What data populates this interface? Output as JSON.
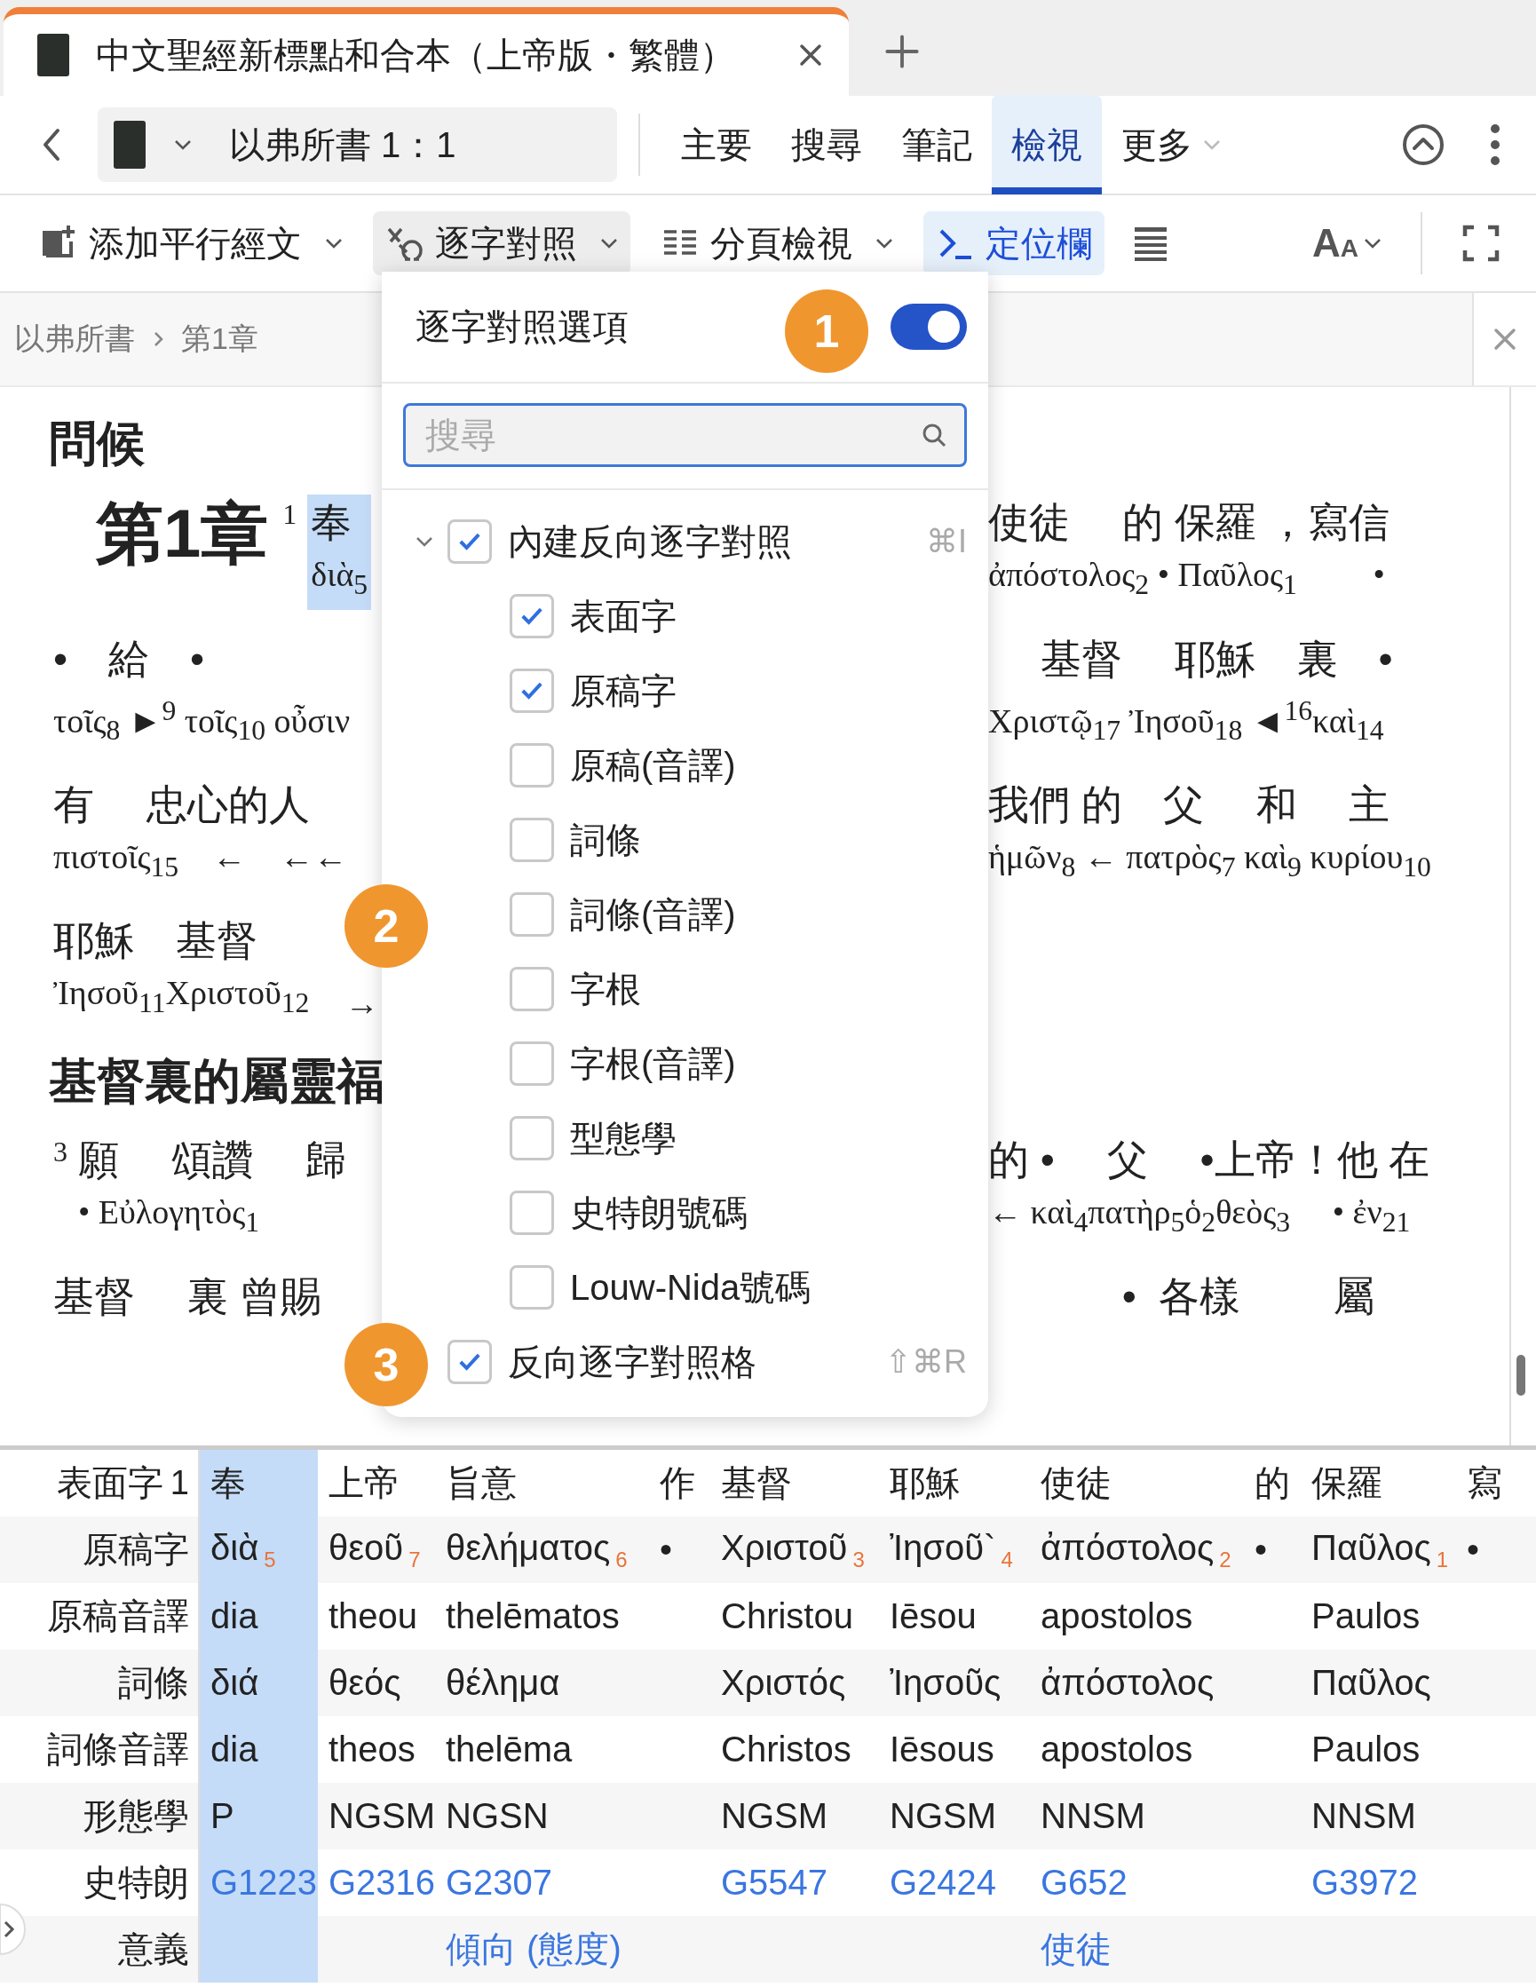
{
  "tab": {
    "title": "中文聖經新標點和合本（上帝版・繁體）"
  },
  "nav": {
    "location": "以弗所書 1：1",
    "tabs": [
      {
        "label": "主要",
        "selected": false,
        "has_menu": false
      },
      {
        "label": "搜尋",
        "selected": false,
        "has_menu": false
      },
      {
        "label": "筆記",
        "selected": false,
        "has_menu": false
      },
      {
        "label": "檢視",
        "selected": true,
        "has_menu": false
      },
      {
        "label": "更多",
        "selected": false,
        "has_menu": true
      }
    ]
  },
  "toolbar": {
    "items": [
      {
        "kind": "add-parallel",
        "label": "添加平行經文",
        "has_menu": true,
        "selected": false
      },
      {
        "kind": "interlinear",
        "label": "逐字對照",
        "has_menu": true,
        "selected": true
      },
      {
        "kind": "pages",
        "label": "分頁檢視",
        "has_menu": true,
        "selected": false
      },
      {
        "kind": "locator",
        "label": "定位欄",
        "has_menu": false,
        "selected": true
      }
    ],
    "font_button": {
      "large": "A",
      "small": "A"
    }
  },
  "breadcrumb": [
    "以弗所書",
    "第1章"
  ],
  "reader": {
    "blocks": [
      {
        "kind": "heading",
        "text": "問候"
      },
      {
        "kind": "line",
        "left": {
          "chapter": "第1章",
          "verse": "1",
          "units": [
            {
              "zh": "奉",
              "gk": "διὰ$_{5}$",
              "selected": true
            }
          ]
        },
        "right": {
          "units": [
            {
              "zh": "使徒　 的 保羅 ，寫信",
              "gk": "ἀπόστολος$_{2}$ • Παῦλος$_{1}$　　 •",
              "selected": false
            }
          ]
        }
      },
      {
        "kind": "line",
        "left": {
          "units": [
            {
              "zh": "•　給　•",
              "gk": "τοῖς$_{8}$ ►$^{9}$ τοῖς$_{10}$ οὖσιν",
              "selected": false
            }
          ]
        },
        "right": {
          "units": [
            {
              "zh": "　 基督　 耶穌　裏　•",
              "gk": "Χριστῷ$_{17}$ Ἰησοῦ$_{18}$ ◄$^{16}$καὶ$_{14}$",
              "selected": false
            }
          ]
        }
      },
      {
        "kind": "line",
        "left": {
          "units": [
            {
              "zh": "有　 忠心的人",
              "gk": "πιστοῖς$_{15}$　←　←←",
              "selected": false
            }
          ]
        },
        "right": {
          "units": [
            {
              "zh": "我們 的　父　 和　 主",
              "gk": "ἡμῶν$_{8}$ ← πατρὸς$_{7}$ καὶ$_{9}$ κυρίου$_{10}$",
              "selected": false
            }
          ]
        }
      },
      {
        "kind": "line",
        "left": {
          "units": [
            {
              "zh": "耶穌　基督",
              "gk": "Ἰησοῦ$_{11}$Χριστοῦ$_{12}$",
              "selected": false
            },
            {
              "gk": "→",
              "selected": false
            }
          ]
        }
      },
      {
        "kind": "heading",
        "text": "基督裏的屬靈福"
      },
      {
        "kind": "line",
        "left": {
          "verse": "3",
          "units": [
            {
              "zh": "願　 頌讚　 歸",
              "gk": "• Εὐλογητὸς$_{1}$",
              "selected": false
            }
          ]
        },
        "right": {
          "units": [
            {
              "zh": "的 •　 父　 •上帝！他 在",
              "gk": "← καὶ$_{4}$πατὴρ$_{5}$ὁ$_{2}$θεὸς$_{3}$　 • ἐν$_{21}$",
              "selected": false
            }
          ]
        }
      },
      {
        "kind": "line",
        "left": {
          "units": [
            {
              "zh": "基督　 裏 曾賜",
              "selected": false
            }
          ]
        },
        "right": {
          "units": [
            {
              "zh": "　　　 •  各樣　　 屬",
              "selected": false
            }
          ]
        }
      }
    ]
  },
  "popup": {
    "title": "逐字對照選項",
    "enabled": true,
    "search": {
      "placeholder": "搜尋"
    },
    "items": [
      {
        "label": "內建反向逐字對照",
        "checked": true,
        "expanded": true,
        "shortcut": "⌘I",
        "children": [
          {
            "label": "表面字",
            "checked": true
          },
          {
            "label": "原稿字",
            "checked": true
          },
          {
            "label": "原稿(音譯)",
            "checked": false
          },
          {
            "label": "詞條",
            "checked": false
          },
          {
            "label": "詞條(音譯)",
            "checked": false
          },
          {
            "label": "字根",
            "checked": false
          },
          {
            "label": "字根(音譯)",
            "checked": false
          },
          {
            "label": "型態學",
            "checked": false
          },
          {
            "label": "史特朗號碼",
            "checked": false
          },
          {
            "label": "Louw-Nida號碼",
            "checked": false
          }
        ]
      },
      {
        "label": "反向逐字對照格",
        "checked": true,
        "shortcut": "⇧⌘R"
      }
    ]
  },
  "callouts": [
    "1",
    "2",
    "3"
  ],
  "table": {
    "verse": "1",
    "row_labels": [
      "表面字",
      "原稿字",
      "原稿音譯",
      "詞條",
      "詞條音譯",
      "形態學",
      "史特朗",
      "意義"
    ],
    "columns": [
      {
        "selected": true,
        "surface": "奉",
        "original": {
          "text": "διὰ",
          "index": "5"
        },
        "translit": "dia",
        "lemma": "διά",
        "lemma_translit": "dia",
        "morph": "P",
        "strong": "G1223"
      },
      {
        "selected": false,
        "surface": "上帝",
        "original": {
          "text": "θεοῦ",
          "index": "7"
        },
        "translit": "theou",
        "lemma": "θεός",
        "lemma_translit": "theos",
        "morph": "NGSM",
        "strong": "G2316"
      },
      {
        "selected": false,
        "surface": "旨意",
        "original": {
          "text": "θελήματος",
          "index": "6"
        },
        "translit": "thelēmatos",
        "lemma": "θέλημα",
        "lemma_translit": "thelēma",
        "morph": "NGSN",
        "strong": "G2307",
        "meaning": "傾向 (態度)"
      },
      {
        "selected": false,
        "surface": "作",
        "original": {
          "text": "•"
        }
      },
      {
        "selected": false,
        "surface": "基督",
        "original": {
          "text": "Χριστοῦ",
          "index": "3"
        },
        "translit": "Christou",
        "lemma": "Χριστός",
        "lemma_translit": "Christos",
        "morph": "NGSM",
        "strong": "G5547"
      },
      {
        "selected": false,
        "surface": "耶穌",
        "original": {
          "text": "Ἰησοῦ`",
          "index": "4"
        },
        "translit": "Iēsou",
        "lemma": "Ἰησοῦς",
        "lemma_translit": "Iēsous",
        "morph": "NGSM",
        "strong": "G2424"
      },
      {
        "selected": false,
        "surface": "使徒",
        "original": {
          "text": "ἀπόστολος",
          "index": "2"
        },
        "translit": "apostolos",
        "lemma": "ἀπόστολος",
        "lemma_translit": "apostolos",
        "morph": "NNSM",
        "strong": "G652",
        "meaning": "使徒"
      },
      {
        "selected": false,
        "surface": "的",
        "original": {
          "text": "•"
        }
      },
      {
        "selected": false,
        "surface": "保羅",
        "original": {
          "text": "Παῦλος",
          "index": "1"
        },
        "translit": "Paulos",
        "lemma": "Παῦλος",
        "lemma_translit": "Paulos",
        "morph": "NNSM",
        "strong": "G3972"
      },
      {
        "selected": false,
        "surface": "寫",
        "original": {
          "text": "•"
        }
      }
    ]
  }
}
